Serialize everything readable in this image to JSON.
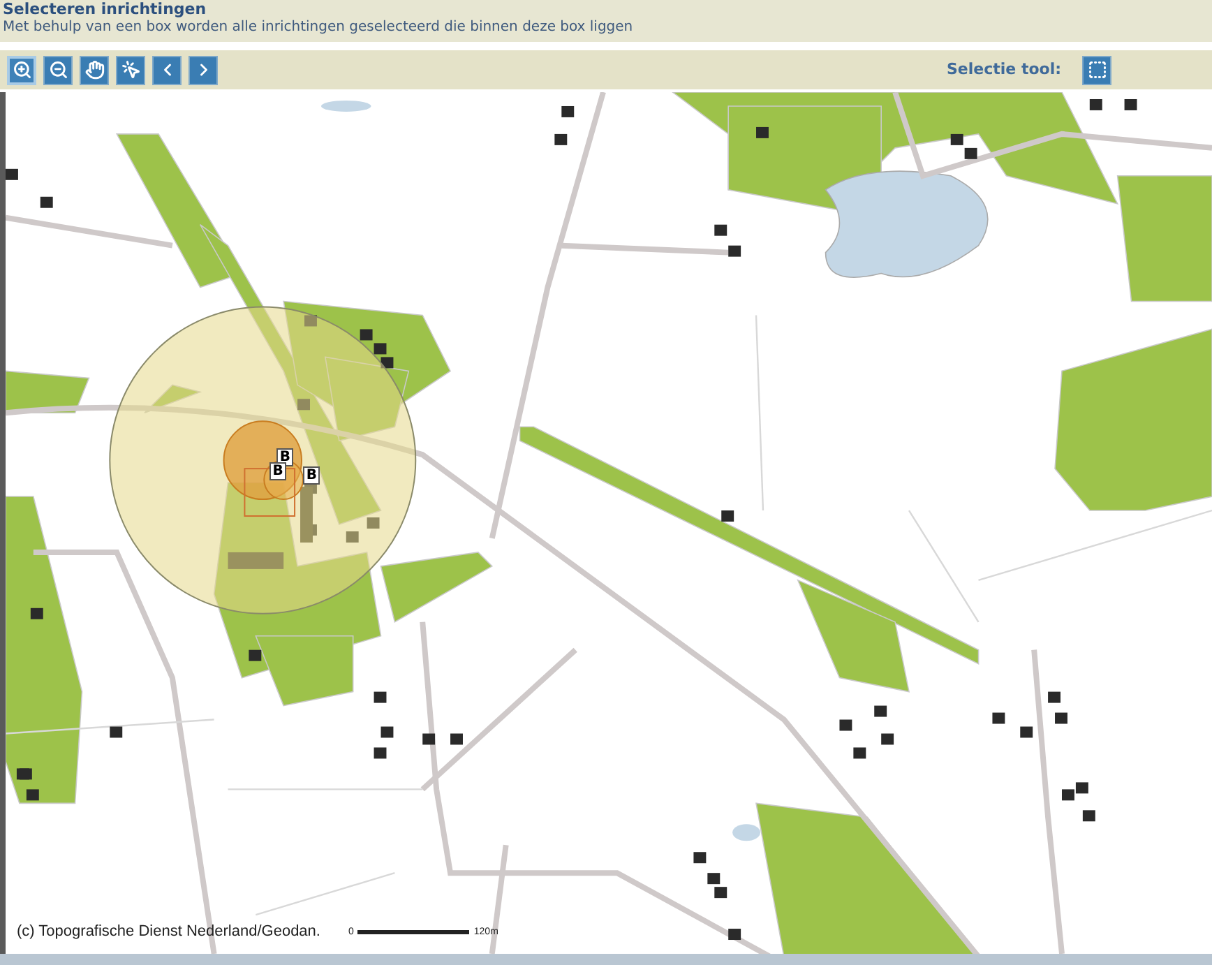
{
  "header": {
    "title": "Selecteren inrichtingen",
    "description": "Met behulp van een box worden alle inrichtingen geselecteerd die binnen deze box liggen"
  },
  "toolbar": {
    "tools": [
      {
        "kind": "zoom-in",
        "selected": true
      },
      {
        "kind": "zoom-out",
        "selected": false
      },
      {
        "kind": "pan",
        "selected": false
      },
      {
        "kind": "identify",
        "selected": false
      },
      {
        "kind": "back",
        "selected": false
      },
      {
        "kind": "forward",
        "selected": false
      }
    ],
    "selection_label": "Selectie tool:"
  },
  "map": {
    "markers": [
      {
        "label": "B"
      },
      {
        "label": "B"
      },
      {
        "label": "B"
      }
    ],
    "attribution": "(c) Topografische Dienst Nederland/Geodan.",
    "scale": {
      "start": "0",
      "end": "120m"
    }
  }
}
